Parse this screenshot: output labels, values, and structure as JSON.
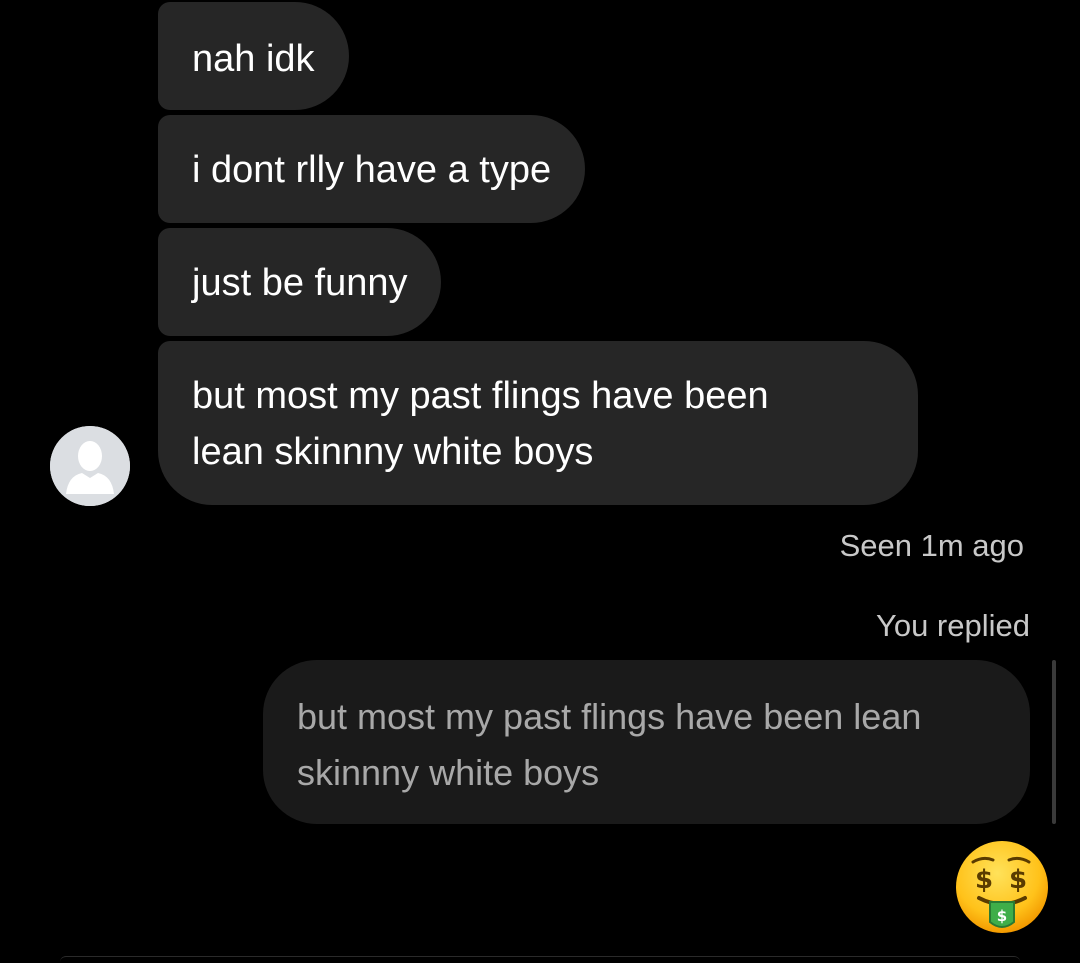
{
  "conversation": {
    "received_messages": [
      {
        "text": "nah idk"
      },
      {
        "text": "i dont rlly have a type"
      },
      {
        "text": "just be funny"
      },
      {
        "lines": [
          "but most my past flings have been",
          "lean skinnny white boys"
        ]
      }
    ],
    "seen_status": "Seen 1m ago",
    "reply_label": "You replied",
    "reply_quote_lines": [
      "but most my past flings have been lean",
      "skinnny white boys"
    ],
    "reply_emoji": "money-mouth-face",
    "reply_emoji_char": "🤑",
    "avatar_icon": "default-profile-silhouette-icon"
  },
  "colors": {
    "background": "#000000",
    "received_bubble": "#262626",
    "reply_quote_bg": "#1a1a1a",
    "reply_quote_text": "#a8a8a8",
    "meta_text": "#c8c8c8"
  }
}
